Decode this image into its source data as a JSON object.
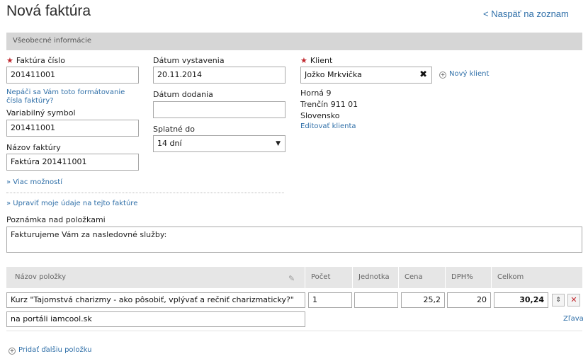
{
  "page": {
    "title": "Nová faktúra",
    "back_link": "< Naspäť na zoznam",
    "section_title": "Všeobecné informácie"
  },
  "invoice": {
    "number_label": "Faktúra číslo",
    "number_value": "201411001",
    "format_hint": "Nepáči sa Vám toto formátovanie čísla faktúry?",
    "variable_symbol_label": "Variabilný symbol",
    "variable_symbol_value": "201411001",
    "name_label": "Názov faktúry",
    "name_value": "Faktúra 201411001",
    "more_options": "» Viac možností",
    "edit_my_data": "» Upraviť moje údaje na tejto faktúre"
  },
  "dates": {
    "issue_label": "Dátum vystavenia",
    "issue_value": "20.11.2014",
    "delivery_label": "Dátum dodania",
    "delivery_value": "",
    "due_label": "Splatné do",
    "due_value": "14 dní"
  },
  "client": {
    "label": "Klient",
    "value": "Jožko Mrkvička",
    "new_client": "Nový klient",
    "address": [
      "Horná 9",
      "Trenčín 911 01",
      "Slovensko"
    ],
    "edit_link": "Editovať klienta"
  },
  "note": {
    "label": "Poznámka nad položkami",
    "value": "Fakturujeme Vám za nasledovné služby:"
  },
  "items_table": {
    "headers": {
      "name": "Názov položky",
      "qty": "Počet",
      "unit": "Jednotka",
      "price": "Cena",
      "vat": "DPH%",
      "total": "Celkom"
    },
    "rows": [
      {
        "name": "Kurz \"Tajomstvá charizmy - ako pôsobiť, vplývať a rečniť charizmaticky?\"",
        "description": "na portáli iamcool.sk",
        "qty": "1",
        "unit": "",
        "price": "25,2",
        "vat": "20",
        "total": "30,24",
        "discount_link": "Zľava"
      }
    ],
    "add_item": "Pridať ďalšiu položku"
  },
  "colors": {
    "link": "#2f6fa8",
    "required_star": "#c0262d",
    "delete": "#c0262d",
    "section_bar": "#d6d6d6",
    "table_header": "#e6e6e6"
  },
  "icons": {
    "required": "asterisk",
    "clear": "close-icon",
    "add": "circle-plus-icon",
    "pencil": "pencil-icon",
    "move": "sort-arrows-icon",
    "delete": "delete-x-icon"
  }
}
